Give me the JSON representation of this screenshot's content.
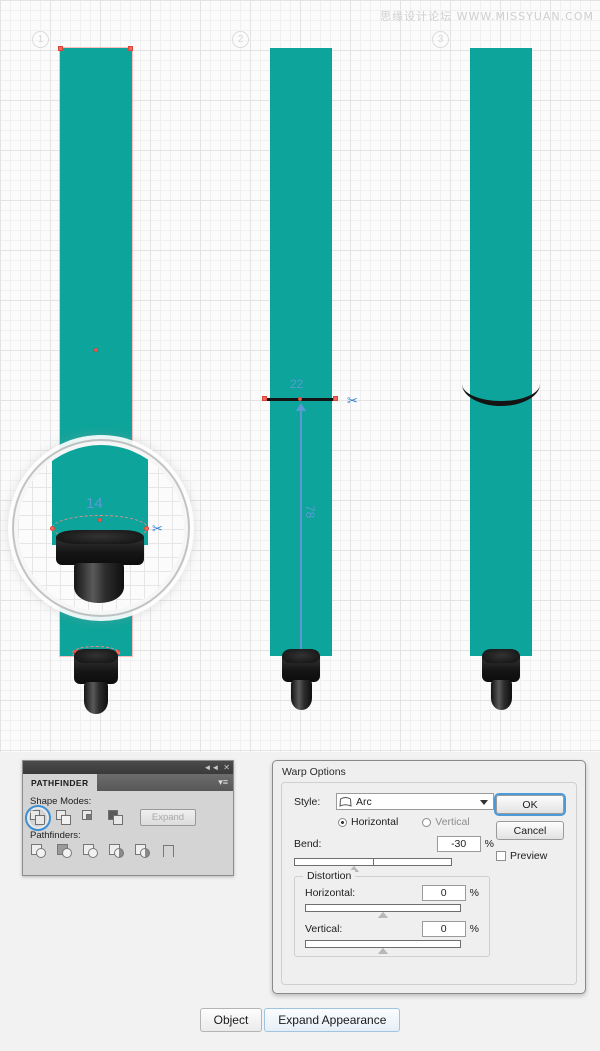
{
  "canvas": {
    "watermark": "思缘设计论坛 WWW.MISSYUAN.COM",
    "background_color": "#fbfbfb",
    "grid_color": "#e3e3e3",
    "steps": [
      {
        "number": "1"
      },
      {
        "number": "2"
      },
      {
        "number": "3"
      }
    ],
    "object_color": "#0da49b",
    "tip_color": "#141414",
    "measure_label_color": "#5b9bd5",
    "anchor_color": "#f4685c",
    "measurements": [
      {
        "name": "magnified-width",
        "value": "14"
      },
      {
        "name": "top-width",
        "value": "22"
      },
      {
        "name": "height",
        "value": "78"
      }
    ]
  },
  "pathfinder": {
    "title_collapse": "◄◄",
    "title_close": "✕",
    "tab_label": "PATHFINDER",
    "panel_menu": "▾≡",
    "shape_modes_label": "Shape Modes:",
    "pathfinders_label": "Pathfinders:",
    "expand_label": "Expand",
    "selected_mode": "unite",
    "selection_color": "#3e8fd4",
    "shape_modes": [
      {
        "name": "unite-button",
        "selected": true
      },
      {
        "name": "minus-front-button",
        "selected": false
      },
      {
        "name": "intersect-button",
        "selected": false
      },
      {
        "name": "exclude-button",
        "selected": false
      }
    ],
    "pathfinder_modes": [
      {
        "name": "divide-button"
      },
      {
        "name": "trim-button"
      },
      {
        "name": "merge-button"
      },
      {
        "name": "crop-button"
      },
      {
        "name": "outline-button"
      },
      {
        "name": "minus-back-button"
      }
    ]
  },
  "warp_options": {
    "title": "Warp Options",
    "style_label": "Style:",
    "style_value": "Arc",
    "orientation": {
      "horizontal_label": "Horizontal",
      "vertical_label": "Vertical",
      "selected": "Horizontal"
    },
    "bend_label": "Bend:",
    "bend_value": "-30",
    "bend_unit": "%",
    "distortion_label": "Distortion",
    "distortion_horizontal_label": "Horizontal:",
    "distortion_horizontal_value": "0",
    "distortion_vertical_label": "Vertical:",
    "distortion_vertical_value": "0",
    "unit": "%",
    "ok_label": "OK",
    "cancel_label": "Cancel",
    "preview_label": "Preview",
    "preview_checked": false,
    "accent_color": "#4b9ada"
  },
  "bottom_bar": {
    "buttons": [
      {
        "label": "Object",
        "accent": false
      },
      {
        "label": "Expand Appearance",
        "accent": true
      }
    ]
  }
}
